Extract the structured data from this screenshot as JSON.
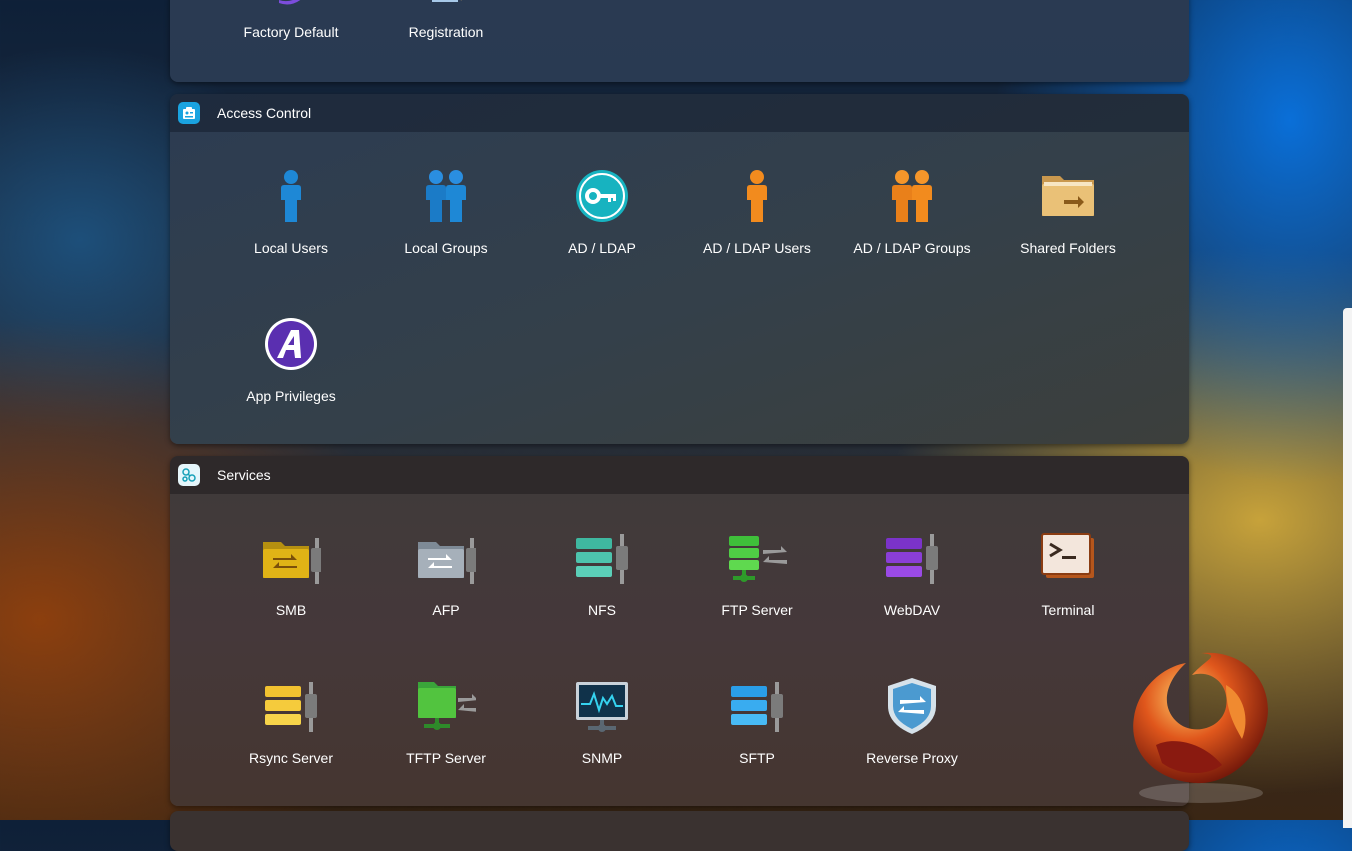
{
  "top_section": {
    "items": [
      {
        "label": "Factory Default",
        "icon": "factory-default-icon"
      },
      {
        "label": "Registration",
        "icon": "registration-icon"
      }
    ]
  },
  "access_control": {
    "title": "Access Control",
    "items": [
      {
        "label": "Local Users",
        "icon": "local-user-icon"
      },
      {
        "label": "Local Groups",
        "icon": "local-groups-icon"
      },
      {
        "label": "AD / LDAP",
        "icon": "key-icon"
      },
      {
        "label": "AD / LDAP Users",
        "icon": "ldap-user-icon"
      },
      {
        "label": "AD / LDAP Groups",
        "icon": "ldap-groups-icon"
      },
      {
        "label": "Shared Folders",
        "icon": "shared-folder-icon"
      },
      {
        "label": "App Privileges",
        "icon": "app-privileges-icon"
      }
    ]
  },
  "services": {
    "title": "Services",
    "items": [
      {
        "label": "SMB",
        "icon": "smb-icon"
      },
      {
        "label": "AFP",
        "icon": "afp-icon"
      },
      {
        "label": "NFS",
        "icon": "nfs-icon"
      },
      {
        "label": "FTP Server",
        "icon": "ftp-server-icon"
      },
      {
        "label": "WebDAV",
        "icon": "webdav-icon"
      },
      {
        "label": "Terminal",
        "icon": "terminal-icon"
      },
      {
        "label": "Rsync Server",
        "icon": "rsync-server-icon"
      },
      {
        "label": "TFTP Server",
        "icon": "tftp-server-icon"
      },
      {
        "label": "SNMP",
        "icon": "snmp-icon"
      },
      {
        "label": "SFTP",
        "icon": "sftp-icon"
      },
      {
        "label": "Reverse Proxy",
        "icon": "reverse-proxy-icon"
      }
    ]
  },
  "colors": {
    "user_blue": "#1e88d6",
    "user_orange": "#f28b1e",
    "teal": "#17b3c0",
    "purple": "#5a2fb0"
  }
}
